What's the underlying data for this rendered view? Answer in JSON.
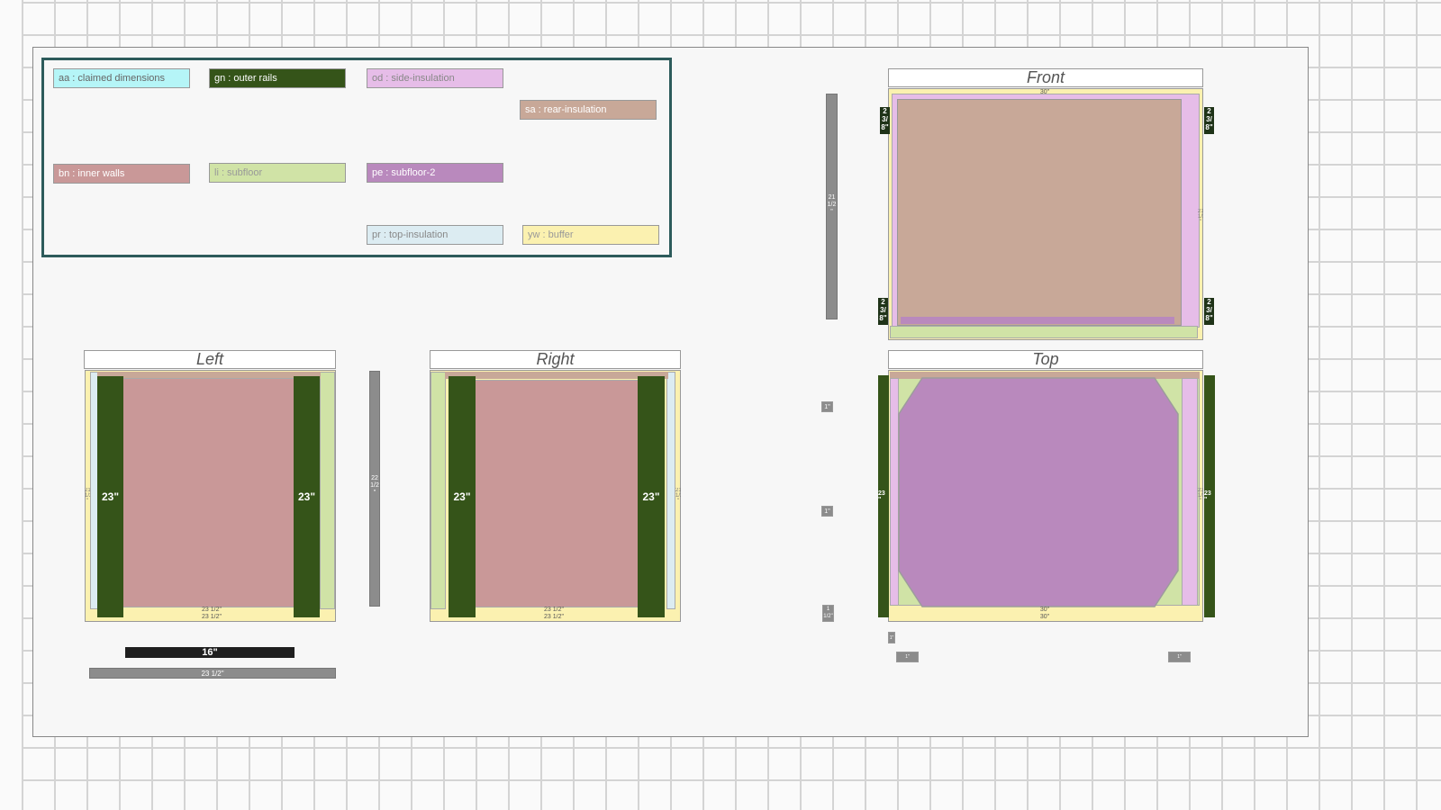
{
  "legend": {
    "aa": {
      "label": "aa : claimed dimensions",
      "color": "#b5f5f7"
    },
    "gn": {
      "label": "gn : outer rails",
      "color": "#355419"
    },
    "od": {
      "label": "od : side-insulation",
      "color": "#e6bde8"
    },
    "sa": {
      "label": "sa : rear-insulation",
      "color": "#c8a898"
    },
    "bn": {
      "label": "bn : inner walls",
      "color": "#c99898"
    },
    "li": {
      "label": "li : subfloor",
      "color": "#d0e3a6"
    },
    "pe": {
      "label": "pe : subfloor-2",
      "color": "#b989bd"
    },
    "pr": {
      "label": "pr : top-insulation",
      "color": "#dcecf2"
    },
    "yw": {
      "label": "yw : buffer",
      "color": "#fbf1b0"
    }
  },
  "views": {
    "front": {
      "title": "Front",
      "width_label": "30\"",
      "corner_badge": "2 3/ 8\"",
      "height_label": "21 1/2 \"",
      "side_label": "21 1/2 \""
    },
    "left": {
      "title": "Left",
      "rail_label": "23\"",
      "bottom_label_a": "23 1/2\"",
      "bottom_label_b": "23 1/2\"",
      "side_label": "21 1/2 \"",
      "height_label": "22 1/2 \""
    },
    "right": {
      "title": "Right",
      "rail_label": "23\"",
      "bottom_label_a": "23 1/2\"",
      "bottom_label_b": "23 1/2\"",
      "side_label": "21 1/2 \""
    },
    "top": {
      "title": "Top",
      "rail_label": "23 \"",
      "bottom_label_a": "30\"",
      "bottom_label_b": "30\"",
      "side_label": "23 1/2 \""
    }
  },
  "measures": {
    "black_bar": "16\"",
    "gray_bar": "23 1/2\"",
    "one_inch": "1\"",
    "one_half": "1 1/2\"",
    "tiny": "1\""
  }
}
